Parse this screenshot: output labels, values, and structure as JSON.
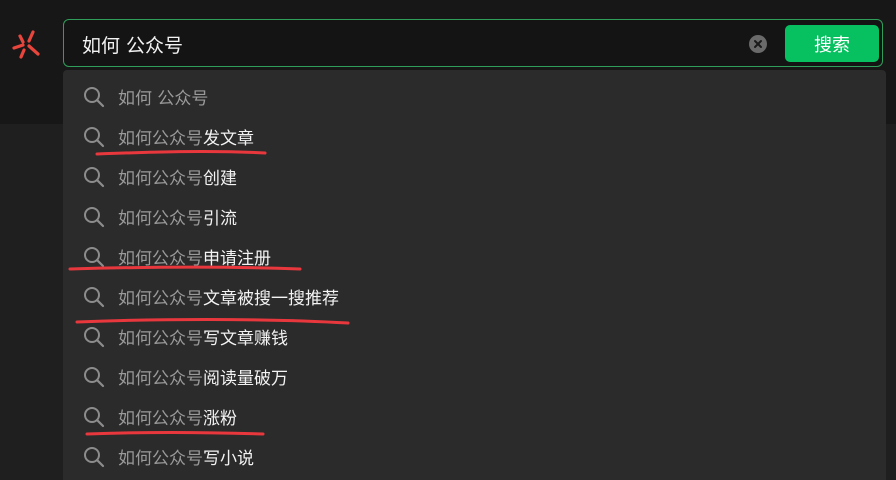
{
  "search": {
    "value": "如何 公众号",
    "button_label": "搜索"
  },
  "suggestions": [
    {
      "prefix": "如何 公众号",
      "suffix": ""
    },
    {
      "prefix": "如何公众号",
      "suffix": "发文章"
    },
    {
      "prefix": "如何公众号",
      "suffix": "创建"
    },
    {
      "prefix": "如何公众号",
      "suffix": "引流"
    },
    {
      "prefix": "如何公众号",
      "suffix": "申请注册"
    },
    {
      "prefix": "如何公众号",
      "suffix": "文章被搜一搜推荐"
    },
    {
      "prefix": "如何公众号",
      "suffix": "写文章赚钱"
    },
    {
      "prefix": "如何公众号",
      "suffix": "阅读量破万"
    },
    {
      "prefix": "如何公众号",
      "suffix": "涨粉"
    },
    {
      "prefix": "如何公众号",
      "suffix": "写小说"
    }
  ],
  "colors": {
    "accent": "#07c160",
    "annotation": "#e8383d"
  }
}
